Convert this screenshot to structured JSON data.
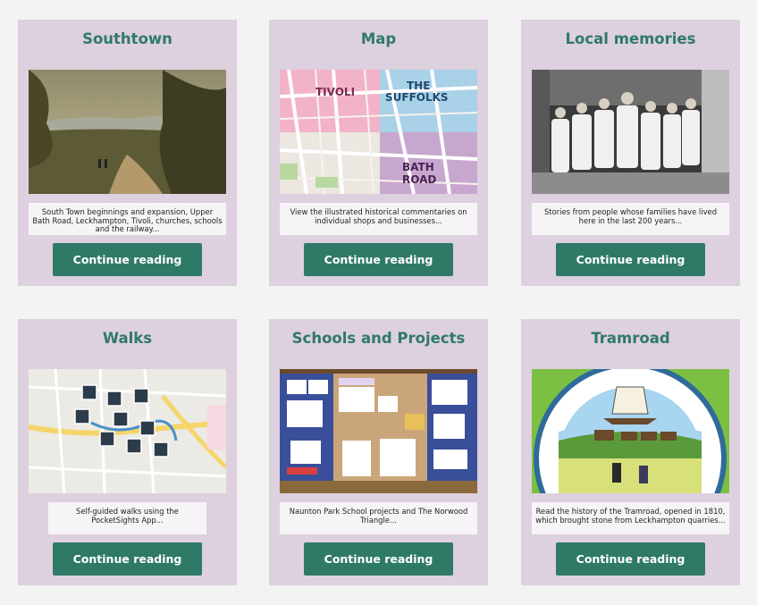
{
  "cards": [
    {
      "title": "Southtown",
      "excerpt": "South Town beginnings and expansion, Upper Bath Road, Leckhampton, Tivoli, churches, schools and the railway...",
      "button": "Continue reading"
    },
    {
      "title": "Map",
      "excerpt": "View the illustrated historical commentaries on individual shops and businesses...",
      "button": "Continue reading",
      "map_labels": [
        "TIVOLI",
        "THE",
        "SUFFOLKS",
        "BATH",
        "ROAD"
      ]
    },
    {
      "title": "Local memories",
      "excerpt": "Stories from people whose families have lived here in the last 200 years...",
      "button": "Continue reading"
    },
    {
      "title": "Walks",
      "excerpt": "Self-guided walks using the PocketSights App...",
      "button": "Continue reading"
    },
    {
      "title": "Schools and Projects",
      "excerpt": "Naunton Park School projects and The Norwood Triangle...",
      "button": "Continue reading"
    },
    {
      "title": "Tramroad",
      "excerpt": "Read the history of the Tramroad, opened in 1810, which brought stone from Leckhampton quarries...",
      "button": "Continue reading"
    }
  ],
  "colors": {
    "page_bg": "#f3f3f3",
    "card_bg": "#ddd0df",
    "accent": "#2f7a66",
    "excerpt_bg": "#f6f4f7"
  }
}
